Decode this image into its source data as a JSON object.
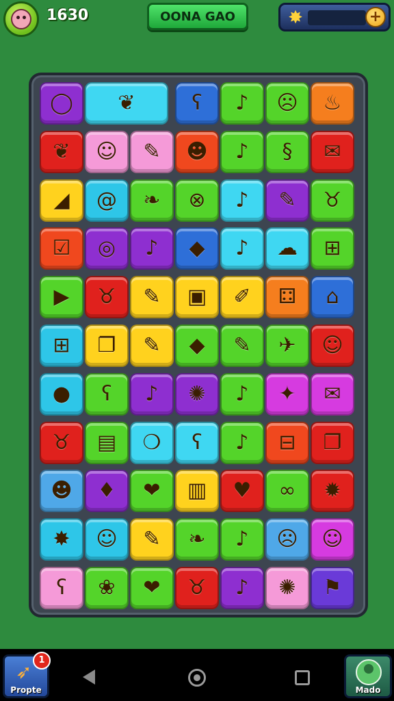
{
  "header": {
    "score": "1630",
    "title": "OONA GAO",
    "avatar_icon": "pig-face-icon",
    "energy_icon": "star-burst-icon",
    "add_icon": "plus-icon",
    "add_symbol": "+"
  },
  "board": {
    "rows": 11,
    "cols": 7,
    "tiles": [
      [
        {
          "icon": "ring-icon",
          "g": "◯",
          "color": "#8e2fd0"
        },
        {
          "icon": "leaf-icon",
          "g": "❦",
          "color": "#3fd7f2"
        },
        {
          "icon": "bear-face-icon",
          "g": "ʕ",
          "color": "#2e6fd8"
        },
        {
          "icon": "note-icon",
          "g": "♪",
          "color": "#54d42a"
        },
        {
          "icon": "monster-face-icon",
          "g": "☹",
          "color": "#54d42a"
        },
        {
          "icon": "flame-face-icon",
          "g": "♨",
          "color": "#f57e1e"
        }
      ],
      [
        {
          "icon": "leaf-icon",
          "g": "❦",
          "color": "#e0211d"
        },
        {
          "icon": "blob-face-icon",
          "g": "☺",
          "color": "#f59ad8"
        },
        {
          "icon": "feather-icon",
          "g": "✎",
          "color": "#f59ad8"
        },
        {
          "icon": "smile-face-icon",
          "g": "☻",
          "color": "#f0481e"
        },
        {
          "icon": "note-icon",
          "g": "♪",
          "color": "#54d42a"
        },
        {
          "icon": "swirl-icon",
          "g": "§",
          "color": "#54d42a"
        },
        {
          "icon": "paper-icon",
          "g": "✉",
          "color": "#e0211d"
        }
      ],
      [
        {
          "icon": "cheese-icon",
          "g": "◢",
          "color": "#ffd21e"
        },
        {
          "icon": "scroll-icon",
          "g": "@",
          "color": "#2ec6e8"
        },
        {
          "icon": "seed-icon",
          "g": "❧",
          "color": "#54d42a"
        },
        {
          "icon": "compass-icon",
          "g": "⊗",
          "color": "#54d42a"
        },
        {
          "icon": "note-icon",
          "g": "♪",
          "color": "#3fd7f2"
        },
        {
          "icon": "feather-icon",
          "g": "✎",
          "color": "#8e2fd0"
        },
        {
          "icon": "pig-face-icon",
          "g": "♉",
          "color": "#54d42a"
        }
      ],
      [
        {
          "icon": "basket-icon",
          "g": "☑",
          "color": "#f0481e"
        },
        {
          "icon": "spiral-icon",
          "g": "◎",
          "color": "#8e2fd0"
        },
        {
          "icon": "note-icon",
          "g": "♪",
          "color": "#8e2fd0"
        },
        {
          "icon": "gem-box-icon",
          "g": "◆",
          "color": "#2e6fd8"
        },
        {
          "icon": "note-icon",
          "g": "♪",
          "color": "#3fd7f2"
        },
        {
          "icon": "ghost-icon",
          "g": "☁",
          "color": "#3fd7f2"
        },
        {
          "icon": "gate-icon",
          "g": "⊞",
          "color": "#54d42a"
        }
      ],
      [
        {
          "icon": "play-icon",
          "g": "▶",
          "color": "#54d42a"
        },
        {
          "icon": "pig-face-icon",
          "g": "♉",
          "color": "#e0211d"
        },
        {
          "icon": "feather-icon",
          "g": "✎",
          "color": "#ffd21e"
        },
        {
          "icon": "box-face-icon",
          "g": "▣",
          "color": "#ffd21e"
        },
        {
          "icon": "bandage-icon",
          "g": "✐",
          "color": "#ffd21e"
        },
        {
          "icon": "dice-icon",
          "g": "⚃",
          "color": "#f57e1e"
        },
        {
          "icon": "house-icon",
          "g": "⌂",
          "color": "#2e6fd8"
        }
      ],
      [
        {
          "icon": "gate-icon",
          "g": "⊞",
          "color": "#2ec6e8"
        },
        {
          "icon": "book-icon",
          "g": "❐",
          "color": "#ffd21e"
        },
        {
          "icon": "feather-icon",
          "g": "✎",
          "color": "#ffd21e"
        },
        {
          "icon": "cube-icon",
          "g": "◆",
          "color": "#54d42a"
        },
        {
          "icon": "feather-icon",
          "g": "✎",
          "color": "#54d42a"
        },
        {
          "icon": "bird-icon",
          "g": "✈",
          "color": "#54d42a"
        },
        {
          "icon": "cat-face-icon",
          "g": "☺",
          "color": "#e0211d"
        }
      ],
      [
        {
          "icon": "balloon-face-icon",
          "g": "●",
          "color": "#2ec6e8"
        },
        {
          "icon": "bear-face-icon",
          "g": "ʕ",
          "color": "#54d42a"
        },
        {
          "icon": "note-icon",
          "g": "♪",
          "color": "#8e2fd0"
        },
        {
          "icon": "sun-icon",
          "g": "✺",
          "color": "#8e2fd0"
        },
        {
          "icon": "note-icon",
          "g": "♪",
          "color": "#54d42a"
        },
        {
          "icon": "wand-icon",
          "g": "✦",
          "color": "#d63be0"
        },
        {
          "icon": "chat-icon",
          "g": "✉",
          "color": "#d63be0"
        }
      ],
      [
        {
          "icon": "pig-face-icon",
          "g": "♉",
          "color": "#e0211d"
        },
        {
          "icon": "card-icon",
          "g": "▤",
          "color": "#54d42a"
        },
        {
          "icon": "drop-icon",
          "g": "❍",
          "color": "#3fd7f2"
        },
        {
          "icon": "bear-face-icon",
          "g": "ʕ",
          "color": "#3fd7f2"
        },
        {
          "icon": "note-icon",
          "g": "♪",
          "color": "#54d42a"
        },
        {
          "icon": "window-icon",
          "g": "⊟",
          "color": "#f0481e"
        },
        {
          "icon": "book-icon",
          "g": "❐",
          "color": "#e0211d"
        }
      ],
      [
        {
          "icon": "frog-face-icon",
          "g": "☻",
          "color": "#4fa8e8"
        },
        {
          "icon": "pepper-icon",
          "g": "♦",
          "color": "#8e2fd0"
        },
        {
          "icon": "apple-icon",
          "g": "❤",
          "color": "#54d42a"
        },
        {
          "icon": "chest-icon",
          "g": "▥",
          "color": "#ffd21e"
        },
        {
          "icon": "cherry-icon",
          "g": "♥",
          "color": "#e0211d"
        },
        {
          "icon": "rings-icon",
          "g": "∞",
          "color": "#54d42a"
        },
        {
          "icon": "gear-icon",
          "g": "✹",
          "color": "#e0211d"
        }
      ],
      [
        {
          "icon": "sun-icon",
          "g": "✸",
          "color": "#2ec6e8"
        },
        {
          "icon": "cat-face-icon",
          "g": "☺",
          "color": "#2ec6e8"
        },
        {
          "icon": "feather-icon",
          "g": "✎",
          "color": "#ffd21e"
        },
        {
          "icon": "pepper-icon",
          "g": "❧",
          "color": "#54d42a"
        },
        {
          "icon": "note-icon",
          "g": "♪",
          "color": "#54d42a"
        },
        {
          "icon": "devil-face-icon",
          "g": "☹",
          "color": "#4fa8e8"
        },
        {
          "icon": "clown-face-icon",
          "g": "☺",
          "color": "#d63be0"
        }
      ],
      [
        {
          "icon": "bear-face-icon",
          "g": "ʕ",
          "color": "#f59ad8"
        },
        {
          "icon": "lilypad-icon",
          "g": "❀",
          "color": "#54d42a"
        },
        {
          "icon": "apple-icon",
          "g": "❤",
          "color": "#54d42a"
        },
        {
          "icon": "pig-face-icon",
          "g": "♉",
          "color": "#e0211d"
        },
        {
          "icon": "note-icon",
          "g": "♪",
          "color": "#8e2fd0"
        },
        {
          "icon": "sun-icon",
          "g": "✺",
          "color": "#f59ad8"
        },
        {
          "icon": "flag-icon",
          "g": "⚑",
          "color": "#6a3ad8"
        }
      ]
    ]
  },
  "footer": {
    "left_button_label": "Propte",
    "left_button_icon": "rocket-icon",
    "left_button_glyph": "➶",
    "left_badge_count": "1",
    "right_button_label": "Mado",
    "right_button_icon": "profile-icon",
    "nav_back_icon": "back-icon",
    "nav_home_icon": "home-icon",
    "nav_recent_icon": "recent-apps-icon"
  }
}
